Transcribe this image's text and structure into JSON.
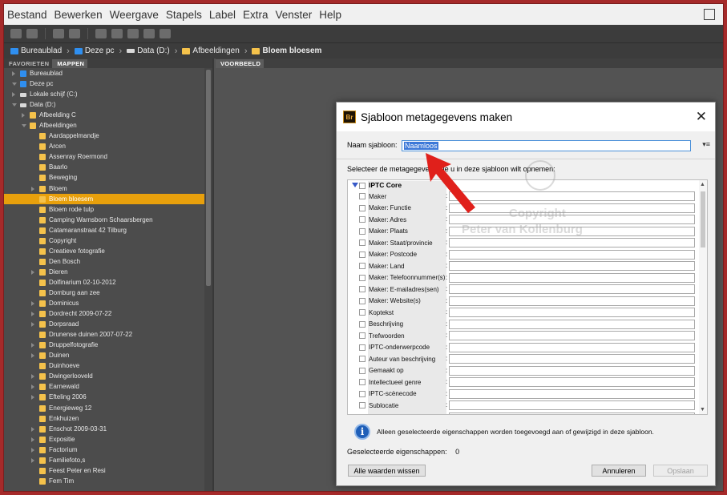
{
  "menu": [
    "Bestand",
    "Bewerken",
    "Weergave",
    "Stapels",
    "Label",
    "Extra",
    "Venster",
    "Help"
  ],
  "breadcrumb": [
    {
      "label": "Bureaublad",
      "icon": "desktop-icon",
      "color": "#2f8ff0",
      "bold": false
    },
    {
      "label": "Deze pc",
      "icon": "computer-icon",
      "color": "#2f8ff0",
      "bold": false
    },
    {
      "label": "Data (D:)",
      "icon": "drive-icon",
      "color": "#d9d9d9",
      "bold": false
    },
    {
      "label": "Afbeeldingen",
      "icon": "pictures-folder-icon",
      "color": "#f5c24b",
      "bold": false
    },
    {
      "label": "Bloem bloesem",
      "icon": "folder-icon",
      "color": "#f5c24b",
      "bold": true
    }
  ],
  "left_panel": {
    "tabs": [
      "FAVORIETEN",
      "MAPPEN"
    ],
    "active_tab": "MAPPEN",
    "tree": [
      {
        "label": "Bureaublad",
        "level": 0,
        "icon": "blue",
        "expand": "closed",
        "selected": false
      },
      {
        "label": "Deze pc",
        "level": 0,
        "icon": "blue",
        "expand": "open",
        "selected": false
      },
      {
        "label": "Lokale schijf (C:)",
        "level": 1,
        "icon": "drive",
        "expand": "closed",
        "selected": false
      },
      {
        "label": "Data (D:)",
        "level": 1,
        "icon": "drive",
        "expand": "open",
        "selected": false
      },
      {
        "label": "Afbeelding C",
        "level": 2,
        "icon": "folder",
        "expand": "closed",
        "selected": false
      },
      {
        "label": "Afbeeldingen",
        "level": 2,
        "icon": "folder",
        "expand": "open",
        "selected": false
      },
      {
        "label": "Aardappelmandje",
        "level": 3,
        "icon": "folder",
        "expand": "none",
        "selected": false
      },
      {
        "label": "Arcen",
        "level": 3,
        "icon": "folder",
        "expand": "none",
        "selected": false
      },
      {
        "label": "Assenray Roermond",
        "level": 3,
        "icon": "folder",
        "expand": "none",
        "selected": false
      },
      {
        "label": "Baarlo",
        "level": 3,
        "icon": "folder",
        "expand": "none",
        "selected": false
      },
      {
        "label": "Beweging",
        "level": 3,
        "icon": "folder",
        "expand": "none",
        "selected": false
      },
      {
        "label": "Bloem",
        "level": 3,
        "icon": "folder",
        "expand": "closed",
        "selected": false
      },
      {
        "label": "Bloem bloesem",
        "level": 3,
        "icon": "folder",
        "expand": "none",
        "selected": true
      },
      {
        "label": "Bloem rode tulp",
        "level": 3,
        "icon": "folder",
        "expand": "none",
        "selected": false
      },
      {
        "label": "Camping Warnsborn Schaarsbergen",
        "level": 3,
        "icon": "folder",
        "expand": "none",
        "selected": false
      },
      {
        "label": "Catamaranstraat 42 Tilburg",
        "level": 3,
        "icon": "folder",
        "expand": "none",
        "selected": false
      },
      {
        "label": "Copyright",
        "level": 3,
        "icon": "folder",
        "expand": "none",
        "selected": false
      },
      {
        "label": "Creatieve fotografie",
        "level": 3,
        "icon": "folder",
        "expand": "none",
        "selected": false
      },
      {
        "label": "Den Bosch",
        "level": 3,
        "icon": "folder",
        "expand": "none",
        "selected": false
      },
      {
        "label": "Dieren",
        "level": 3,
        "icon": "folder",
        "expand": "closed",
        "selected": false
      },
      {
        "label": "Dolfinarium 02-10-2012",
        "level": 3,
        "icon": "folder",
        "expand": "none",
        "selected": false
      },
      {
        "label": "Domburg aan zee",
        "level": 3,
        "icon": "folder",
        "expand": "none",
        "selected": false
      },
      {
        "label": "Dominicus",
        "level": 3,
        "icon": "folder",
        "expand": "closed",
        "selected": false
      },
      {
        "label": "Dordrecht 2009-07-22",
        "level": 3,
        "icon": "folder",
        "expand": "closed",
        "selected": false
      },
      {
        "label": "Dorpsraad",
        "level": 3,
        "icon": "folder",
        "expand": "closed",
        "selected": false
      },
      {
        "label": "Drunense duinen 2007-07-22",
        "level": 3,
        "icon": "folder",
        "expand": "none",
        "selected": false
      },
      {
        "label": "Druppelfotografie",
        "level": 3,
        "icon": "folder",
        "expand": "closed",
        "selected": false
      },
      {
        "label": "Duinen",
        "level": 3,
        "icon": "folder",
        "expand": "closed",
        "selected": false
      },
      {
        "label": "Duinhoeve",
        "level": 3,
        "icon": "folder",
        "expand": "none",
        "selected": false
      },
      {
        "label": "Dwingerlooveld",
        "level": 3,
        "icon": "folder",
        "expand": "closed",
        "selected": false
      },
      {
        "label": "Earnewald",
        "level": 3,
        "icon": "folder",
        "expand": "closed",
        "selected": false
      },
      {
        "label": "Efteling 2006",
        "level": 3,
        "icon": "folder",
        "expand": "closed",
        "selected": false
      },
      {
        "label": "Energieweg 12",
        "level": 3,
        "icon": "folder",
        "expand": "none",
        "selected": false
      },
      {
        "label": "Enkhuizen",
        "level": 3,
        "icon": "folder",
        "expand": "none",
        "selected": false
      },
      {
        "label": "Enschot 2009-03-31",
        "level": 3,
        "icon": "folder",
        "expand": "closed",
        "selected": false
      },
      {
        "label": "Expositie",
        "level": 3,
        "icon": "folder",
        "expand": "closed",
        "selected": false
      },
      {
        "label": "Factorium",
        "level": 3,
        "icon": "folder",
        "expand": "closed",
        "selected": false
      },
      {
        "label": "Familiefoto,s",
        "level": 3,
        "icon": "folder",
        "expand": "closed",
        "selected": false
      },
      {
        "label": "Feest Peter en Resi",
        "level": 3,
        "icon": "folder",
        "expand": "none",
        "selected": false
      },
      {
        "label": "Fem Tim",
        "level": 3,
        "icon": "folder",
        "expand": "none",
        "selected": false
      }
    ]
  },
  "preview_panel": {
    "tab": "VOORBEELD"
  },
  "dialog": {
    "title": "Sjabloon metagegevens maken",
    "app_icon_text": "Br",
    "name_label": "Naam sjabloon:",
    "name_value": "Naamloos",
    "select_prompt": "Selecteer de metagegevens die u in deze sjabloon wilt opnemen:",
    "section": "IPTC Core",
    "fields": [
      "Maker",
      "Maker: Functie",
      "Maker: Adres",
      "Maker: Plaats",
      "Maker: Staat/provincie",
      "Maker: Postcode",
      "Maker: Land",
      "Maker: Telefoonnummer(s)",
      "Maker: E-mailadres(sen)",
      "Maker: Website(s)",
      "Koptekst",
      "Beschrijving",
      "Trefwoorden",
      "IPTC-onderwerpcode",
      "Auteur van beschrijving",
      "Gemaakt op",
      "Intellectueel genre",
      "IPTC-scènecode",
      "Sublocatie",
      "Plaats"
    ],
    "info_text": "Alleen geselecteerde eigenschappen worden toegevoegd aan of gewijzigd in deze sjabloon.",
    "selected_label": "Geselecteerde eigenschappen:",
    "selected_count": "0",
    "clear_button": "Alle waarden wissen",
    "cancel_button": "Annuleren",
    "save_button": "Opslaan"
  },
  "watermark": {
    "line1": "Copyright",
    "line2": "Peter van Kollenburg"
  },
  "colors": {
    "selection": "#e8a00c",
    "accent": "#3b78d8",
    "arrow": "#e0201b",
    "frame": "#a52a2a"
  }
}
